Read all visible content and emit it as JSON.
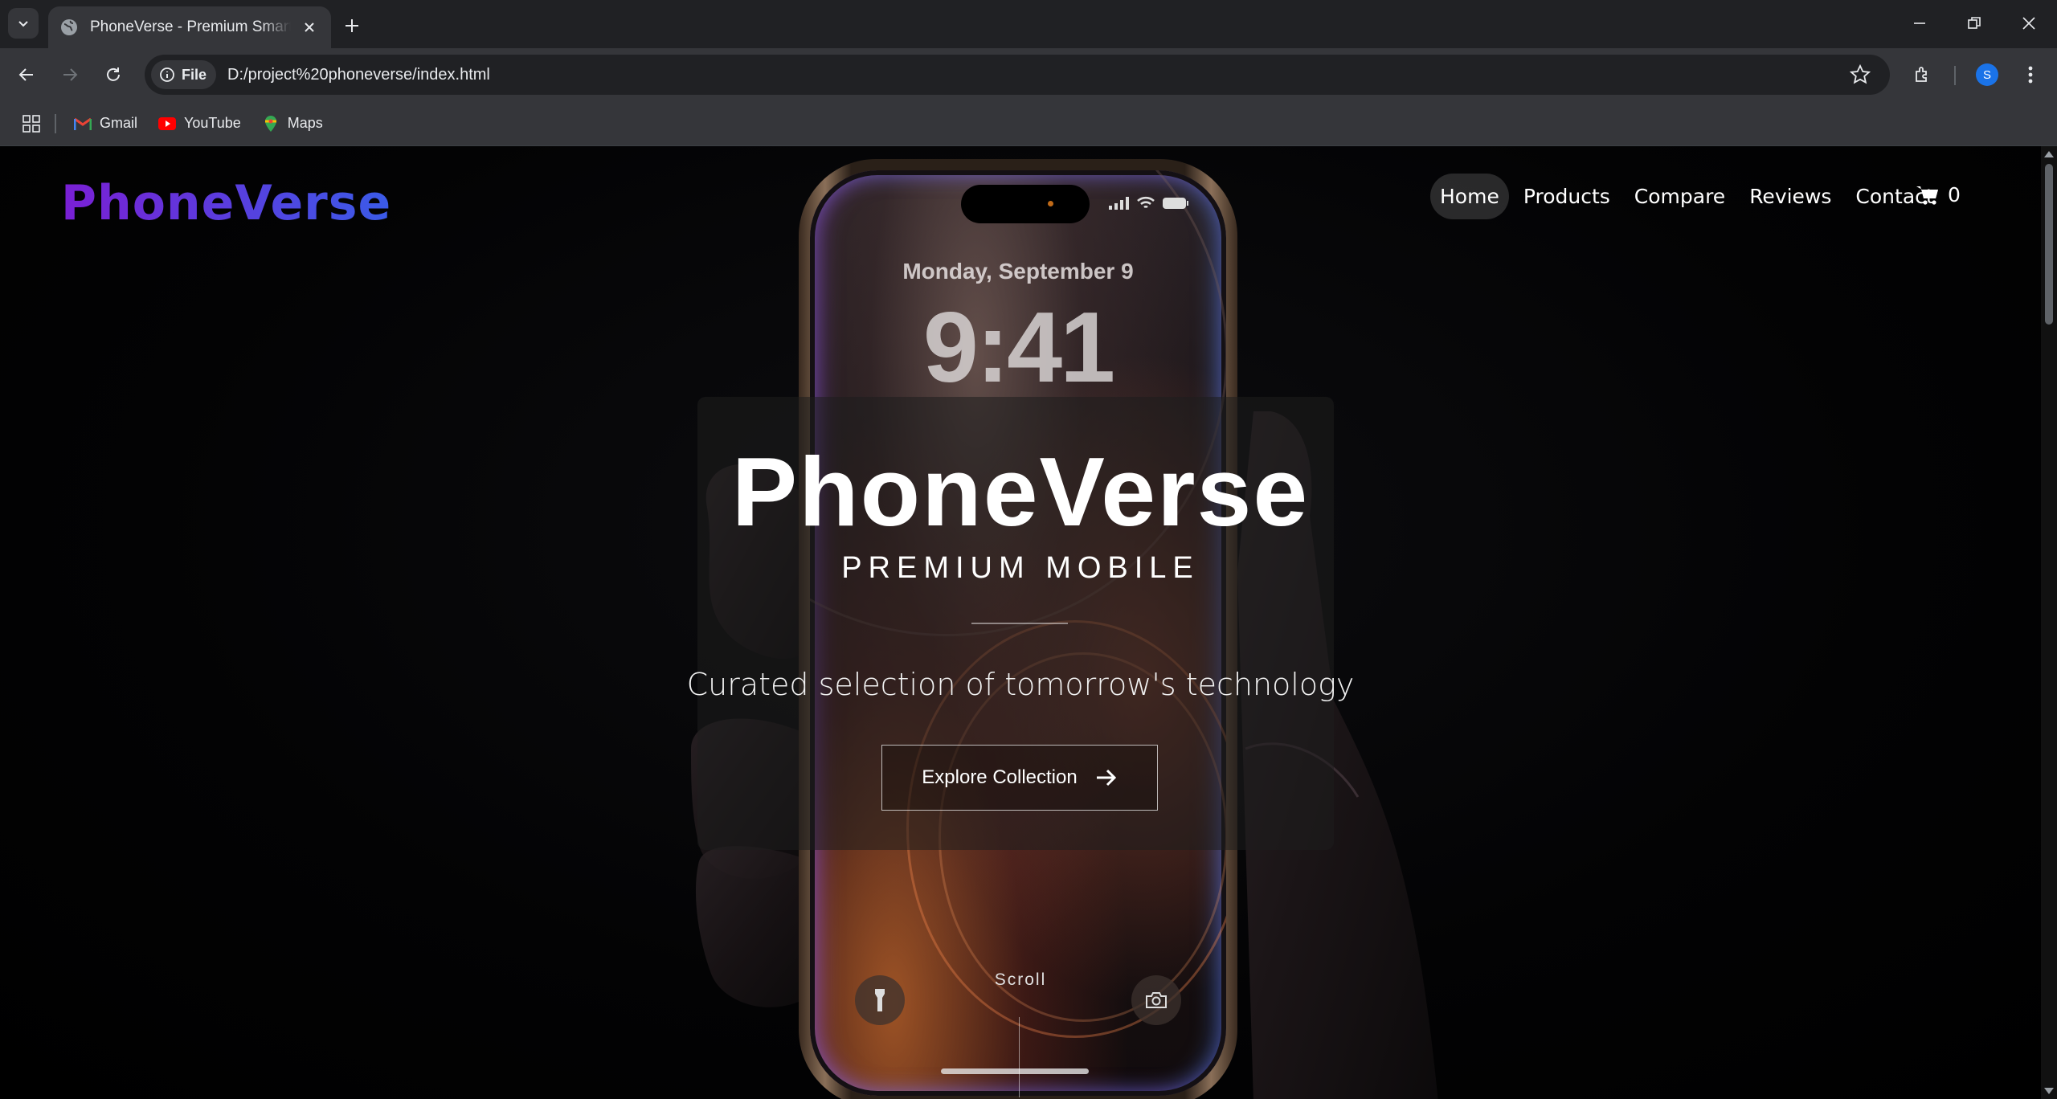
{
  "browser": {
    "tab_title": "PhoneVerse - Premium Smartphones",
    "url": "D:/project%20phoneverse/index.html",
    "site_chip": "File",
    "profile_initial": "S",
    "bookmarks": [
      {
        "label": "Gmail",
        "icon": "gmail-icon"
      },
      {
        "label": "YouTube",
        "icon": "youtube-icon"
      },
      {
        "label": "Maps",
        "icon": "maps-icon"
      }
    ]
  },
  "site": {
    "logo": "PhoneVerse",
    "brand_colors": [
      "#7a1fd4",
      "#3a5be8"
    ],
    "nav": [
      {
        "label": "Home",
        "active": true
      },
      {
        "label": "Products",
        "active": false
      },
      {
        "label": "Compare",
        "active": false
      },
      {
        "label": "Reviews",
        "active": false
      },
      {
        "label": "Contact",
        "active": false
      }
    ],
    "cart_count": "0"
  },
  "phone_screen": {
    "date": "Monday, September 9",
    "time": "9:41"
  },
  "hero": {
    "title": "PhoneVerse",
    "subtitle": "PREMIUM MOBILE",
    "tagline": "Curated selection of tomorrow's technology",
    "cta": "Explore Collection",
    "scroll_label": "Scroll"
  }
}
